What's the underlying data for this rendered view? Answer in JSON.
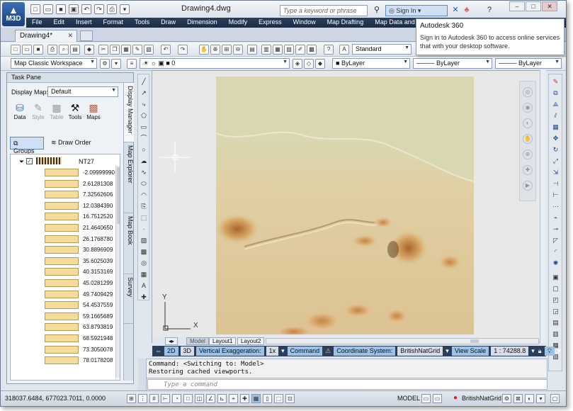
{
  "app": {
    "logo": "M3D",
    "document_title": "Drawing4.dwg",
    "search_placeholder": "Type a keyword or phrase",
    "sign_in": "Sign In"
  },
  "menu": [
    "File",
    "Edit",
    "Insert",
    "Format",
    "Tools",
    "Draw",
    "Dimension",
    "Modify",
    "Express",
    "Window",
    "Map Drafting",
    "Map Data and An"
  ],
  "doc_tab": "Drawing4*",
  "toolbar": {
    "text_style": "Standard",
    "workspace": "Map Classic Workspace",
    "layer": "0",
    "color": "ByLayer",
    "linetype": "ByLayer",
    "lineweight": "ByLayer"
  },
  "popup": {
    "title": "Autodesk 360",
    "body": "Sign in to Autodesk 360 to access online services that with your desktop software."
  },
  "task_pane": {
    "title": "Task Pane",
    "display_map_label": "Display Map:",
    "display_map_value": "Default",
    "icons": [
      "Data",
      "Style",
      "Table",
      "Tools",
      "Maps"
    ],
    "groups": "Groups",
    "draw_order": "Draw Order",
    "layer_name": "NT27",
    "legend": [
      "-2.09999990",
      "2.61281308",
      "7.32562606",
      "12.0384390",
      "16.7512520",
      "21.4640650",
      "26.1768780",
      "30.8896909",
      "35.6025039",
      "40.3153169",
      "45.0281299",
      "49.7409429",
      "54.4537559",
      "59.1665689",
      "63.8793819",
      "68.5921948",
      "73.3050078",
      "78.0178208"
    ],
    "vertical_tabs": [
      "Display Manager",
      "Map Explorer",
      "Map Book",
      "Survey"
    ]
  },
  "colors": {
    "legend_swatch": "#f6dc9c",
    "terrain_base": "#d9d7b2",
    "status_blue": "#9cc2e6",
    "menubar": "#1c2c44"
  },
  "layouts": [
    "Model",
    "Layout1",
    "Layout2"
  ],
  "map_status": {
    "two_d": "2D",
    "three_d": "3D",
    "vert_exag_label": "Vertical Exaggeration:",
    "vert_exag_value": "1x",
    "command": "Command",
    "coord_label": "Coordinate System:",
    "coord_value": "BritishNatGrid",
    "view_scale_label": "View Scale",
    "view_scale_value": "1 : 74288.8"
  },
  "command_history": [
    "Command:   <Switching to: Model>",
    "Restoring cached viewports."
  ],
  "command_placeholder": "Type a command",
  "ucs": {
    "x": "X",
    "y": "Y"
  },
  "statusbar": {
    "coordinates": "318037.6484, 677023.7011, 0.0000",
    "model": "MODEL",
    "coord_system": "BritishNatGrid"
  }
}
